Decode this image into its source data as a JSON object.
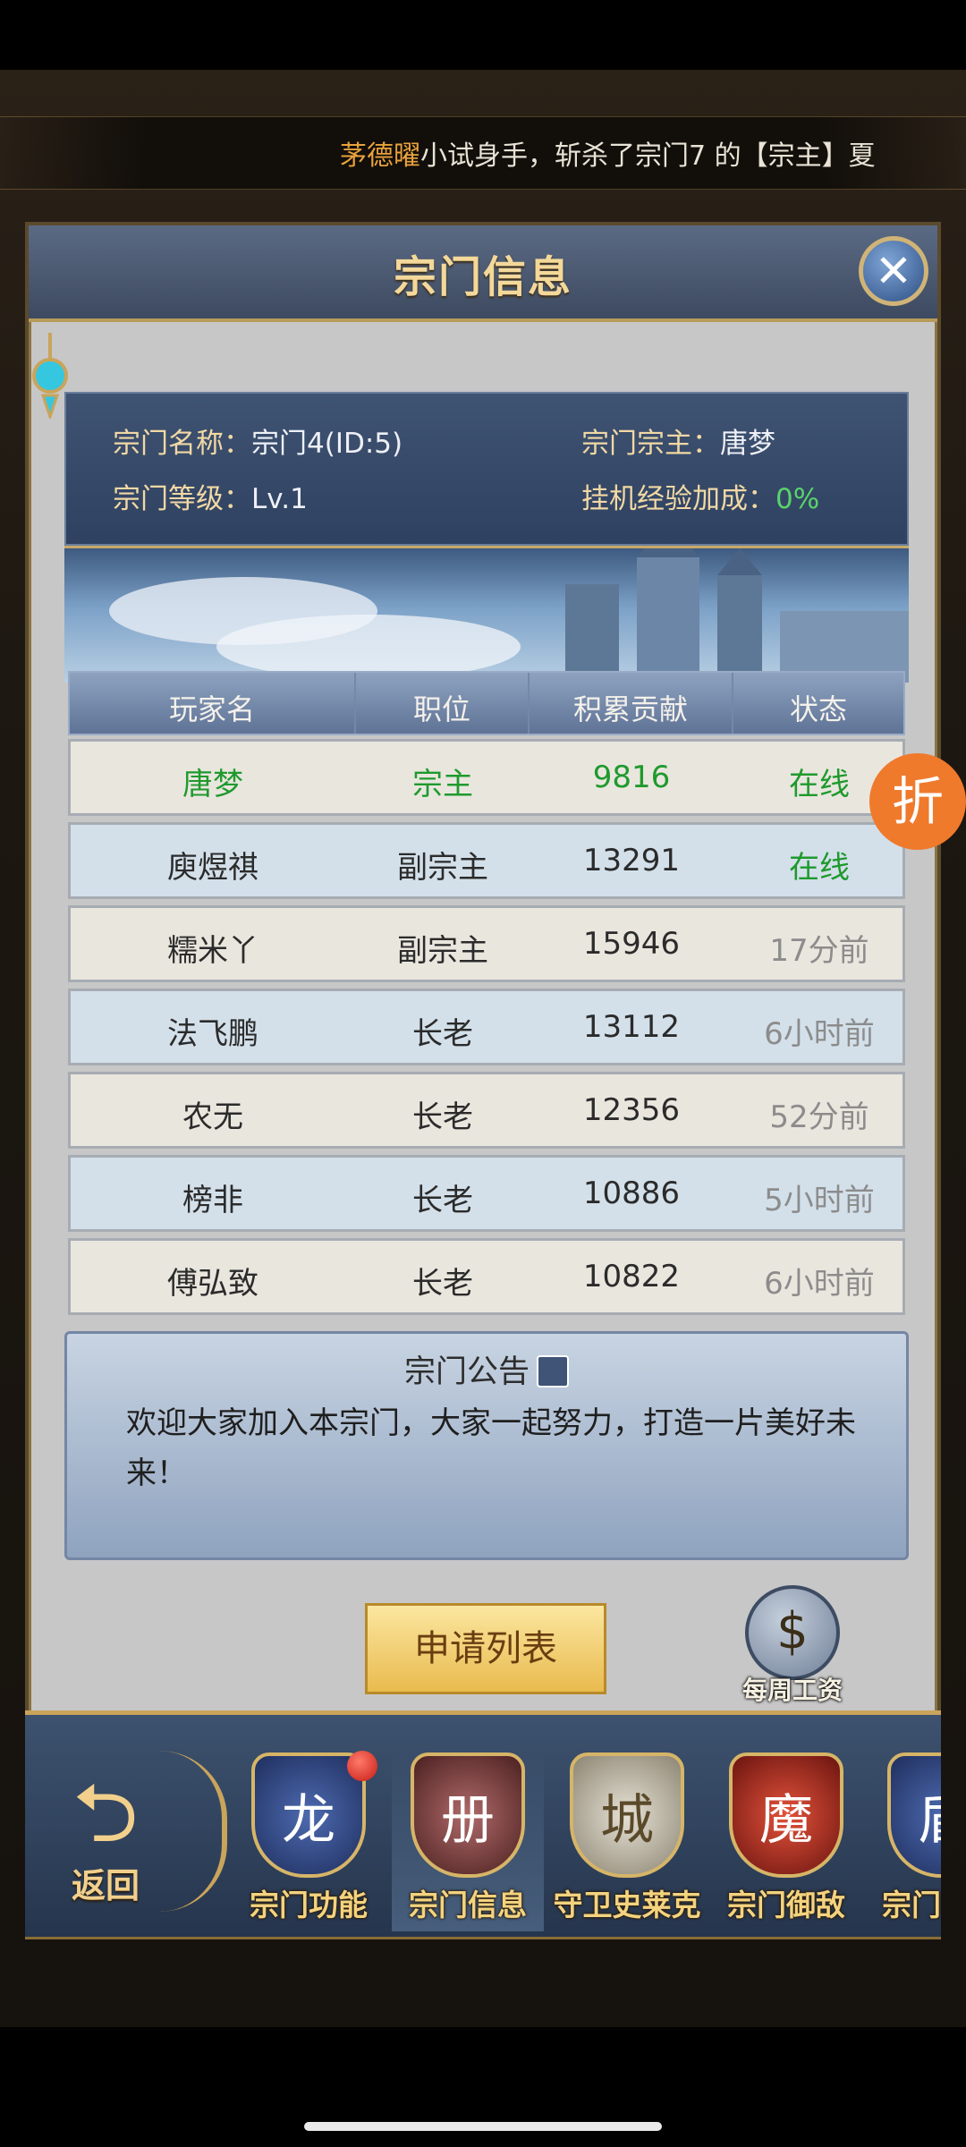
{
  "ticker": {
    "player_name": "茅德曜",
    "message": "小试身手，斩杀了宗门7 的【宗主】夏"
  },
  "panel": {
    "title": "宗门信息",
    "close_icon": "✕"
  },
  "sect_info": {
    "name_label": "宗门名称：",
    "name_value": "宗门4(ID:5)",
    "leader_label": "宗门宗主：",
    "leader_value": "唐梦",
    "level_label": "宗门等级：",
    "level_value": "Lv.1",
    "exp_label": "挂机经验加成：",
    "exp_value": "0%"
  },
  "table": {
    "headers": [
      "玩家名",
      "职位",
      "积累贡献",
      "状态"
    ],
    "rows": [
      {
        "name": "唐梦",
        "role": "宗主",
        "contribution": "9816",
        "status": "在线"
      },
      {
        "name": "庾煜祺",
        "role": "副宗主",
        "contribution": "13291",
        "status": "在线"
      },
      {
        "name": "糯米丫",
        "role": "副宗主",
        "contribution": "15946",
        "status": "17分前"
      },
      {
        "name": "法飞鹏",
        "role": "长老",
        "contribution": "13112",
        "status": "6小时前"
      },
      {
        "name": "农无",
        "role": "长老",
        "contribution": "12356",
        "status": "52分前"
      },
      {
        "name": "榜非",
        "role": "长老",
        "contribution": "10886",
        "status": "5小时前"
      },
      {
        "name": "傅弘致",
        "role": "长老",
        "contribution": "10822",
        "status": "6小时前"
      }
    ]
  },
  "notice": {
    "title": "宗门公告",
    "body": "欢迎大家加入本宗门，大家一起努力，打造一片美好未来！"
  },
  "buttons": {
    "apply_list": "申请列表",
    "weekly_salary": "每周工资",
    "salary_symbol": "$"
  },
  "sale_badge": "折",
  "navbar": {
    "back_label": "返回",
    "back_icon": "⮌",
    "items": [
      {
        "label": "宗门功能",
        "glyph": "龙"
      },
      {
        "label": "宗门信息",
        "glyph": "册"
      },
      {
        "label": "守卫史莱克",
        "glyph": "城"
      },
      {
        "label": "宗门御敌",
        "glyph": "魔"
      },
      {
        "label": "宗门",
        "glyph": "盾"
      }
    ]
  },
  "colors": {
    "accent_gold": "#f3d89a",
    "online_green": "#1f9a2d",
    "exp_green": "#58d36b",
    "ticker_name": "#e8a23c"
  }
}
